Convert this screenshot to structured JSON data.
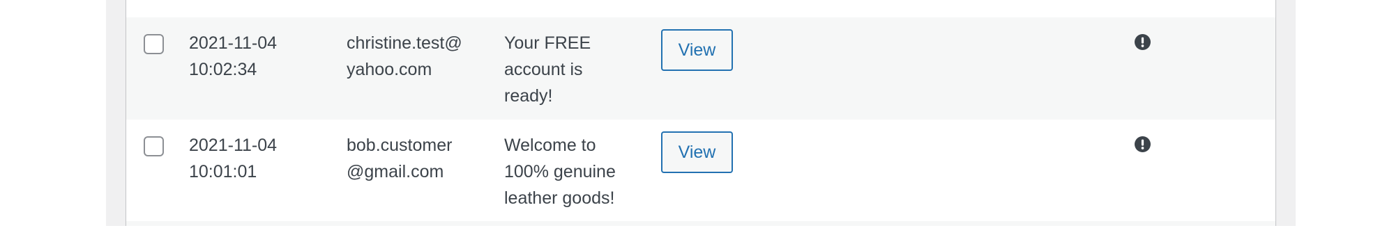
{
  "rows": [
    {
      "date": "2021-11-04",
      "time": "10:02:34",
      "email_line1": "christine.test@",
      "email_line2": "yahoo.com",
      "subject_line1": "Your FREE",
      "subject_line2": "account is",
      "subject_line3": "ready!",
      "action_label": "View",
      "status_icon": "alert-icon"
    },
    {
      "date": "2021-11-04",
      "time": "10:01:01",
      "email_line1": "bob.customer",
      "email_line2": "@gmail.com",
      "subject_line1": "Welcome to",
      "subject_line2": "100% genuine",
      "subject_line3": "leather goods!",
      "action_label": "View",
      "status_icon": "alert-icon"
    }
  ],
  "colors": {
    "accent": "#2271b1",
    "text": "#3c434a",
    "row_alt": "#f6f7f7",
    "page_bg": "#f0f0f1",
    "border": "#c3c4c7"
  }
}
